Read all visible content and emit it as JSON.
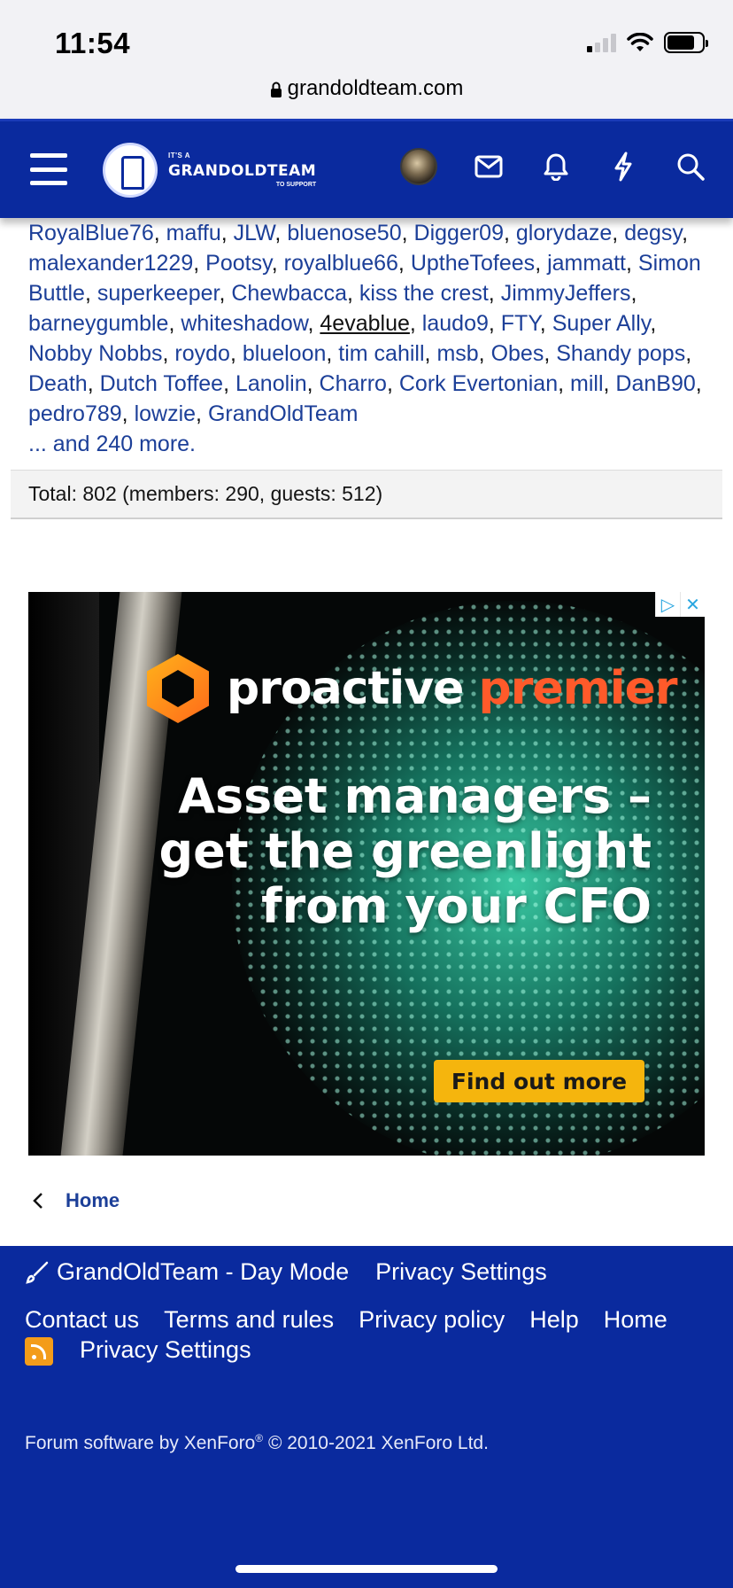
{
  "status_bar": {
    "time": "11:54"
  },
  "browser": {
    "url": "grandoldteam.com"
  },
  "header": {
    "logo_small": "IT'S A",
    "logo_big": "GRANDOLDTEAM",
    "logo_sub": "TO SUPPORT"
  },
  "online": {
    "partial_line": "__ ______, ______, ______, ____________, __________,",
    "users": [
      "RoyalBlue76",
      "maffu",
      "JLW",
      "bluenose50",
      "Digger09",
      "glorydaze",
      "degsy",
      "malexander1229",
      "Pootsy",
      "royalblue66",
      "UptheTofees",
      "jammatt",
      "Simon Buttle",
      "superkeeper",
      "Chewbacca",
      "kiss the crest",
      "JimmyJeffers",
      "barneygumble",
      "whiteshadow",
      "4evablue",
      "laudo9",
      "FTY",
      "Super Ally",
      "Nobby Nobbs",
      "roydo",
      "blueloon",
      "tim cahill",
      "msb",
      "Obes",
      "Shandy pops",
      "Death",
      "Dutch Toffee",
      "Lanolin",
      "Charro",
      "Cork Evertonian",
      "mill",
      "DanB90",
      "pedro789",
      "lowzie",
      "GrandOldTeam"
    ],
    "more": "... and 240 more.",
    "total": "Total: 802 (members: 290, guests: 512)"
  },
  "ad": {
    "brand_first": "proactive",
    "brand_second": "premier",
    "headline_1": "Asset managers –",
    "headline_2": "get the greenlight",
    "headline_3": "from your CFO",
    "cta": "Find out more",
    "badge_icon": "ad-choices-icon",
    "close_icon": "close-icon"
  },
  "breadcrumb": {
    "label": "Home"
  },
  "footer": {
    "style_label": "GrandOldTeam - Day Mode",
    "privacy_top": "Privacy Settings",
    "links": [
      "Contact us",
      "Terms and rules",
      "Privacy policy",
      "Help",
      "Home"
    ],
    "privacy_bottom": "Privacy Settings",
    "copyright_a": "Forum software by XenForo",
    "copyright_reg": "®",
    "copyright_b": " © 2010-2021 XenForo Ltd."
  },
  "colors": {
    "brand_blue": "#0a2a9e",
    "link_blue": "#1c3f98",
    "cta_yellow": "#f5b50d",
    "rss_orange": "#f39c1a"
  }
}
